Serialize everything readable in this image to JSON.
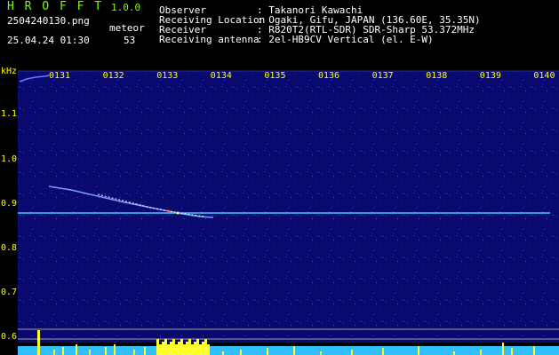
{
  "app": {
    "name": "H R O F F T",
    "version": "1.0.0",
    "filename": "2504240130.png",
    "mode": "meteor",
    "datetime": "25.04.24 01:30",
    "count": "53"
  },
  "info": {
    "rows": [
      {
        "label": "Observer",
        "value": ": Takanori Kawachi"
      },
      {
        "label": "Receiving Location",
        "value": ": Ogaki, Gifu, JAPAN (136.60E, 35.35N)"
      },
      {
        "label": "Receiver",
        "value": ": R820T2(RTL-SDR) SDR-Sharp 53.372MHz"
      },
      {
        "label": "Receiving antenna",
        "value": ": 2el-HB9CV Vertical (el. E-W)"
      }
    ]
  },
  "axis": {
    "unit": "kHz",
    "y_ticks": [
      "1.1",
      "1.0",
      "0.9",
      "0.8",
      "0.7",
      "0.6"
    ],
    "x_ticks": [
      "0131",
      "0132",
      "0133",
      "0134",
      "0135",
      "0136",
      "0137",
      "0138",
      "0139",
      "0140"
    ]
  },
  "colors": {
    "background": "#0a0a6e",
    "carrier": "#40d0ff",
    "meteor": "#ffffff",
    "text_green": "#7CFC00",
    "text_yellow": "#ffff00"
  }
}
